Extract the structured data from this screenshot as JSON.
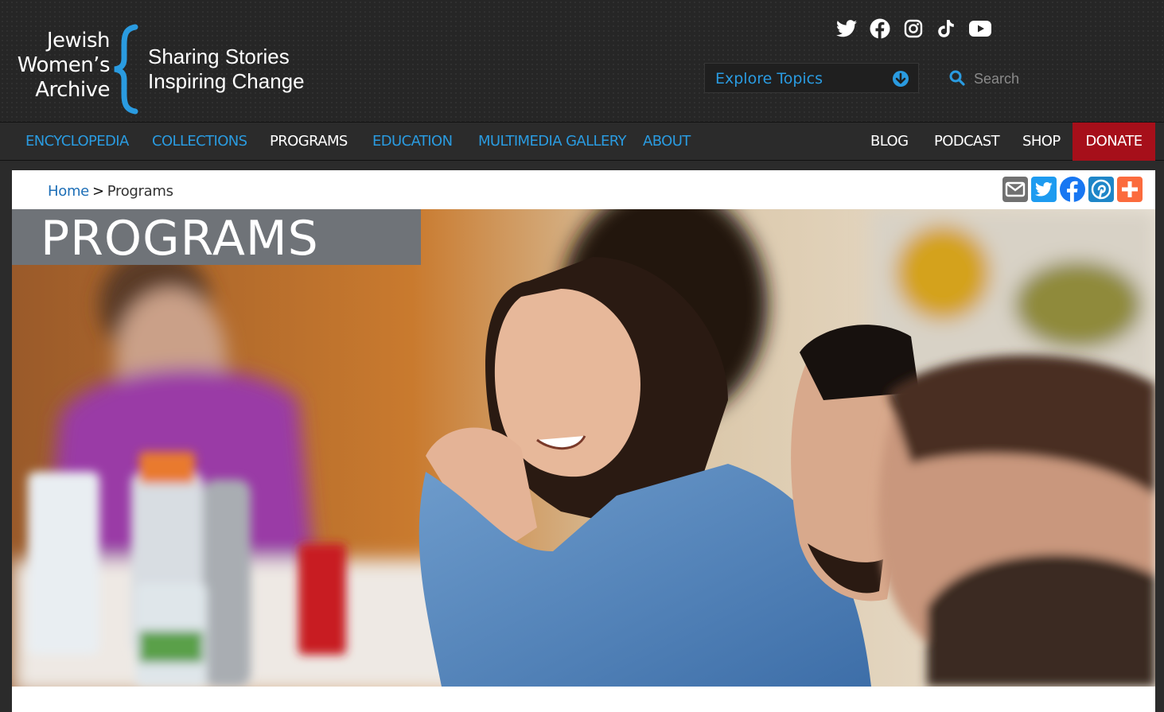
{
  "logo": {
    "line1": "Jewish",
    "line2": "Women’s",
    "line3": "Archive"
  },
  "tagline": {
    "line1": "Sharing Stories",
    "line2": "Inspiring Change"
  },
  "social": [
    "twitter-icon",
    "facebook-icon",
    "instagram-icon",
    "tiktok-icon",
    "youtube-icon"
  ],
  "explore": {
    "label": "Explore Topics"
  },
  "search": {
    "placeholder": "Search"
  },
  "nav": {
    "encyclopedia": "ENCYCLOPEDIA",
    "collections": "COLLECTIONS",
    "programs": "PROGRAMS",
    "education": "EDUCATION",
    "multimedia": "MULTIMEDIA GALLERY",
    "about": "ABOUT",
    "blog": "BLOG",
    "podcast": "PODCAST",
    "shop": "SHOP",
    "donate": "DONATE"
  },
  "breadcrumb": {
    "home": "Home",
    "sep": ">",
    "current": "Programs"
  },
  "share": [
    "email-icon",
    "twitter-icon",
    "facebook-icon",
    "pinterest-icon",
    "plus-icon"
  ],
  "page_title": "PROGRAMS",
  "colors": {
    "accent": "#2a9be0",
    "donate": "#a60f1a",
    "header_bg": "#262626",
    "title_box": "#6f7378"
  }
}
